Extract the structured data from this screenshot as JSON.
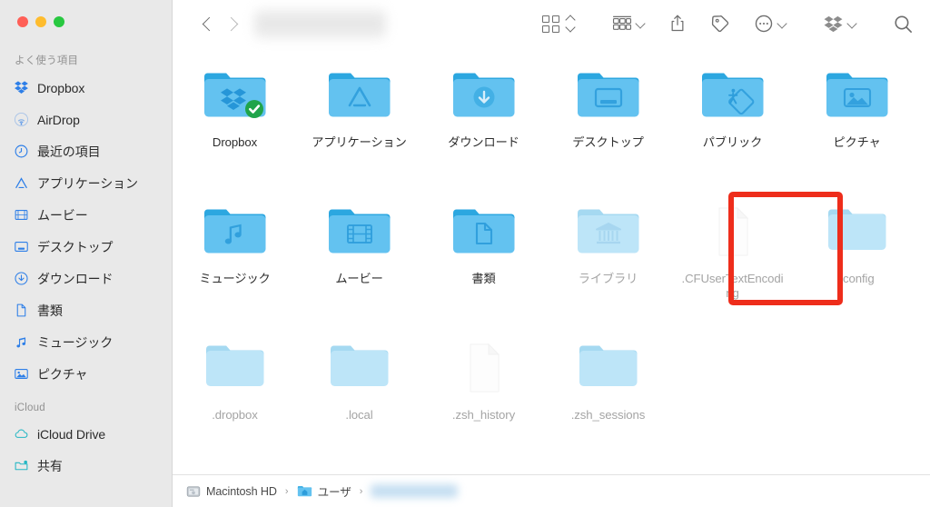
{
  "window": {
    "title_redacted": true,
    "traffic_lights": [
      {
        "name": "close",
        "color": "#ff5f57"
      },
      {
        "name": "minimize",
        "color": "#febc2e"
      },
      {
        "name": "maximize",
        "color": "#28c840"
      }
    ]
  },
  "sidebar": {
    "sections": [
      {
        "title": "よく使う項目",
        "items": [
          {
            "label": "Dropbox",
            "icon": "dropbox-icon"
          },
          {
            "label": "AirDrop",
            "icon": "airdrop-icon"
          },
          {
            "label": "最近の項目",
            "icon": "clock-icon"
          },
          {
            "label": "アプリケーション",
            "icon": "applications-icon"
          },
          {
            "label": "ムービー",
            "icon": "movies-icon"
          },
          {
            "label": "デスクトップ",
            "icon": "desktop-icon"
          },
          {
            "label": "ダウンロード",
            "icon": "downloads-icon"
          },
          {
            "label": "書類",
            "icon": "documents-icon"
          },
          {
            "label": "ミュージック",
            "icon": "music-icon"
          },
          {
            "label": "ピクチャ",
            "icon": "pictures-icon"
          }
        ]
      },
      {
        "title": "iCloud",
        "items": [
          {
            "label": "iCloud Drive",
            "icon": "cloud-icon"
          },
          {
            "label": "共有",
            "icon": "shared-folder-icon"
          }
        ]
      }
    ]
  },
  "toolbar": {
    "back_label": "戻る",
    "forward_label": "進む",
    "view_switch_label": "表示方法",
    "group_by_label": "グループ分け",
    "share_label": "共有",
    "tag_label": "タグ",
    "more_label": "その他",
    "dropbox_label": "Dropbox",
    "search_label": "検索"
  },
  "files": {
    "rows": [
      [
        {
          "name": "Dropbox",
          "type": "folder",
          "icon": "dropbox-folder-icon",
          "hidden": false,
          "badge": "sync-check-badge"
        },
        {
          "name": "アプリケーション",
          "type": "folder",
          "icon": "applications-folder-icon",
          "hidden": false
        },
        {
          "name": "ダウンロード",
          "type": "folder",
          "icon": "downloads-folder-icon",
          "hidden": false
        },
        {
          "name": "デスクトップ",
          "type": "folder",
          "icon": "desktop-folder-icon",
          "hidden": false
        },
        {
          "name": "パブリック",
          "type": "folder",
          "icon": "public-folder-icon",
          "hidden": false
        },
        {
          "name": "ピクチャ",
          "type": "folder",
          "icon": "pictures-folder-icon",
          "hidden": false
        }
      ],
      [
        {
          "name": "ミュージック",
          "type": "folder",
          "icon": "music-folder-icon",
          "hidden": false
        },
        {
          "name": "ムービー",
          "type": "folder",
          "icon": "movies-folder-icon",
          "hidden": false
        },
        {
          "name": "書類",
          "type": "folder",
          "icon": "documents-folder-icon",
          "hidden": false
        },
        {
          "name": "ライブラリ",
          "type": "folder",
          "icon": "library-folder-icon",
          "hidden": true,
          "highlighted": true
        },
        {
          "name": ".CFUserTextEncoding",
          "type": "file",
          "icon": "generic-file-icon",
          "hidden": true
        },
        {
          "name": ".config",
          "type": "folder",
          "icon": "plain-folder-icon",
          "hidden": true
        }
      ],
      [
        {
          "name": ".dropbox",
          "type": "folder",
          "icon": "plain-folder-icon",
          "hidden": true
        },
        {
          "name": ".local",
          "type": "folder",
          "icon": "plain-folder-icon",
          "hidden": true
        },
        {
          "name": ".zsh_history",
          "type": "file",
          "icon": "generic-file-icon",
          "hidden": true
        },
        {
          "name": ".zsh_sessions",
          "type": "folder",
          "icon": "plain-folder-icon",
          "hidden": true
        }
      ]
    ]
  },
  "pathbar": {
    "crumbs": [
      {
        "label": "Macintosh HD",
        "icon": "hard-drive-icon",
        "redacted": false
      },
      {
        "label": "ユーザ",
        "icon": "home-folder-icon",
        "redacted": false
      },
      {
        "label": "",
        "icon": "none",
        "redacted": true
      }
    ],
    "separator": "›"
  },
  "annotation": {
    "highlight_color": "#ee2d1b",
    "target": "ライブラリ"
  }
}
